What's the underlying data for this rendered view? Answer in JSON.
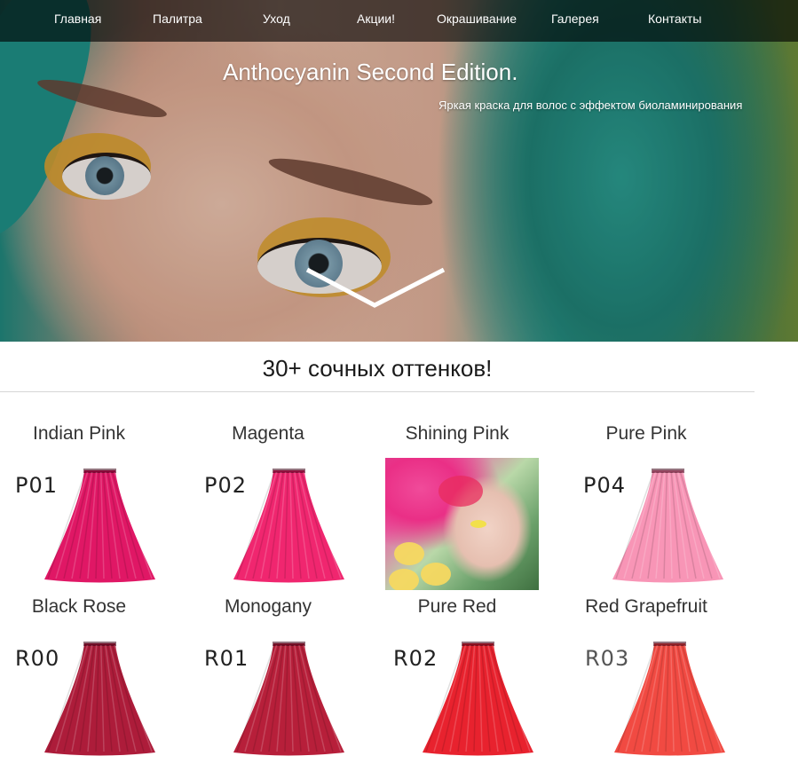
{
  "nav": {
    "items": [
      "Главная",
      "Палитра",
      "Уход",
      "Акции!",
      "Окрашивание",
      "Галерея",
      "Контакты"
    ]
  },
  "hero": {
    "title": "Anthocyanin Second Edition.",
    "subtitle": "Яркая краска для волос с эффектом биоламинирования"
  },
  "palette": {
    "heading": "30+ сочных оттенков!",
    "swatches": [
      {
        "name": "Indian Pink",
        "code": "P01",
        "color": "#e01765"
      },
      {
        "name": "Magenta",
        "code": "P02",
        "color": "#f0266f"
      },
      {
        "name": "Shining Pink",
        "code": "",
        "color": "#e94d97"
      },
      {
        "name": "Pure Pink",
        "code": "P04",
        "color": "#f895b6"
      },
      {
        "name": "Black Rose",
        "code": "R00",
        "color": "#ad1c3a"
      },
      {
        "name": "Monogany",
        "code": "R01",
        "color": "#b71f3a"
      },
      {
        "name": "Pure Red",
        "code": "R02",
        "color": "#e8222e"
      },
      {
        "name": "Red Grapefruit",
        "code": "R03",
        "color": "#f14a42"
      }
    ]
  },
  "colors": {
    "nav_bg": "#1c1c1c",
    "text": "#333333"
  }
}
